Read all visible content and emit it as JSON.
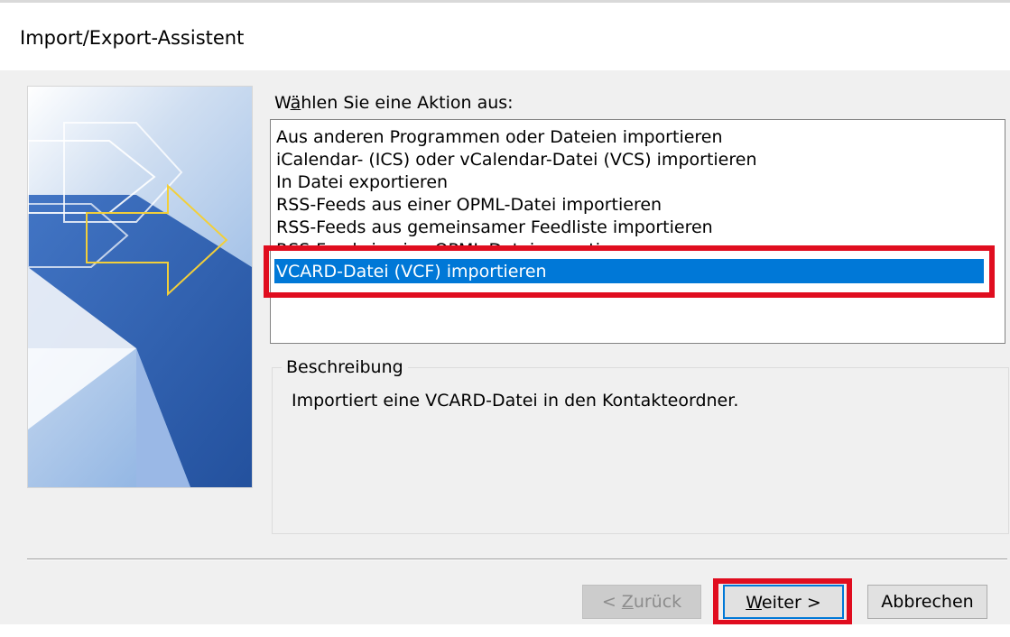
{
  "window": {
    "title": "Import/Export-Assistent"
  },
  "prompt": {
    "label": "Wählen Sie eine Aktion aus:"
  },
  "actions": {
    "items": [
      "Aus anderen Programmen oder Dateien importieren",
      "iCalendar- (ICS) oder vCalendar-Datei (VCS) importieren",
      "In Datei exportieren",
      "RSS-Feeds aus einer OPML-Datei importieren",
      "RSS-Feeds aus gemeinsamer Feedliste importieren",
      "RSS-Feeds in eine OPML-Datei exportieren",
      "VCARD-Datei (VCF) importieren"
    ],
    "selected": "VCARD-Datei (VCF) importieren"
  },
  "description": {
    "heading": "Beschreibung",
    "text": "Importiert eine VCARD-Datei in den Kontakteordner."
  },
  "buttons": {
    "back": "< Zurück",
    "next": "Weiter >",
    "cancel": "Abbrechen"
  },
  "colors": {
    "selection": "#0078d7",
    "highlight": "#e00d1f",
    "arrow_outline": "#f2cf3a"
  }
}
